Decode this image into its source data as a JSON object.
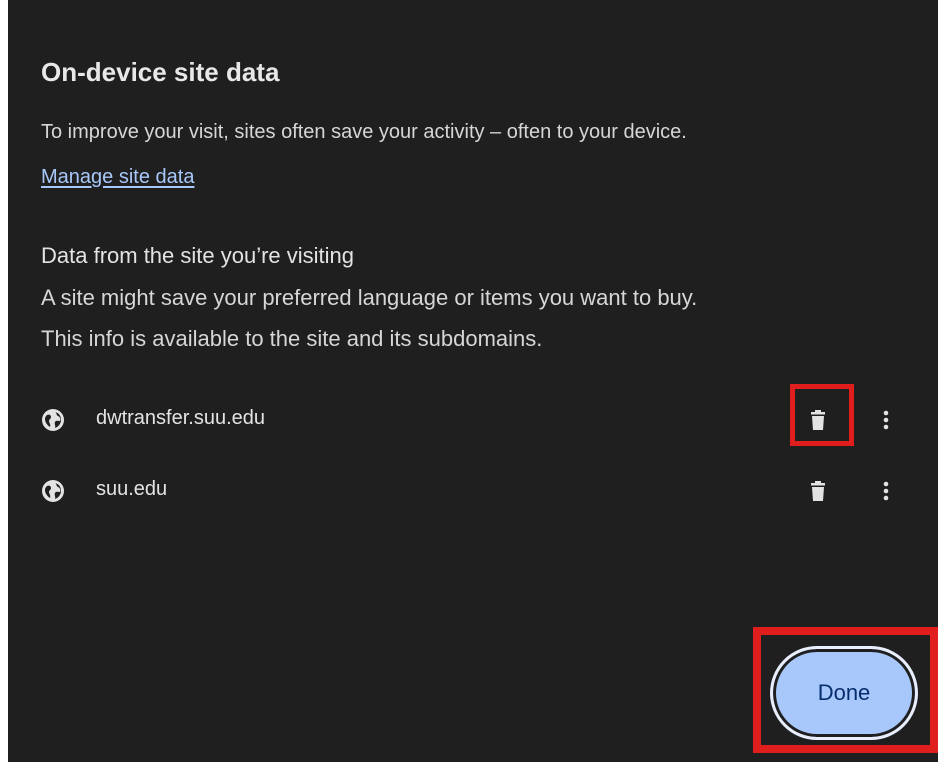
{
  "dialog": {
    "title": "On-device site data",
    "description": "To improve your visit, sites often save your activity – often to your device.",
    "manage_link": "Manage site data",
    "section": {
      "heading": "Data from the site you’re visiting",
      "line1": "A site might save your preferred language or items you want to buy.",
      "line2": "This info is available to the site and its subdomains."
    },
    "sites": [
      {
        "name": "dwtransfer.suu.edu",
        "icon": "globe-icon",
        "delete_icon": "trash-icon",
        "more_icon": "more-vert-icon"
      },
      {
        "name": "suu.edu",
        "icon": "globe-icon",
        "delete_icon": "trash-icon",
        "more_icon": "more-vert-icon"
      }
    ],
    "done_label": "Done"
  },
  "colors": {
    "background": "#1f1f1f",
    "link": "#a8c7fa",
    "button_fill": "#a8c7fa",
    "button_text": "#062e6f",
    "highlight": "#e01e1e"
  }
}
